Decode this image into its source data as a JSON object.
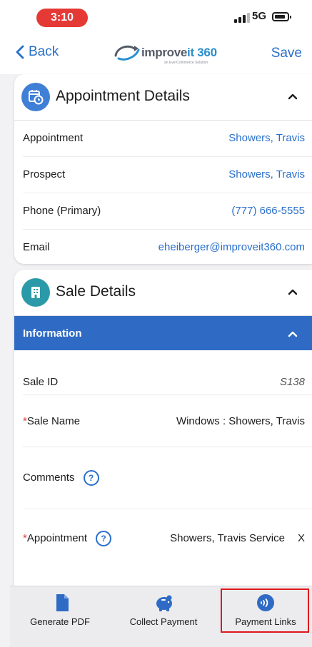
{
  "status": {
    "time": "3:10",
    "network": "5G"
  },
  "nav": {
    "back_label": "Back",
    "logo_main": "improve",
    "logo_accent": "it 360",
    "logo_sub": "an EverCommerce Solution",
    "save_label": "Save"
  },
  "appointment_details": {
    "title": "Appointment Details",
    "rows": [
      {
        "label": "Appointment",
        "value": "Showers, Travis"
      },
      {
        "label": "Prospect",
        "value": "Showers, Travis"
      },
      {
        "label": "Phone (Primary)",
        "value": "(777) 666-5555"
      },
      {
        "label": "Email",
        "value": "eheiberger@improveit360.com"
      }
    ]
  },
  "sale_details": {
    "title": "Sale Details",
    "section_label": "Information",
    "sale_id_label": "Sale ID",
    "sale_id_value": "S138",
    "sale_name_label": "Sale Name",
    "sale_name_value": "Windows : Showers, Travis",
    "comments_label": "Comments",
    "appointment_label": "Appointment",
    "appointment_value": "Showers, Travis Service",
    "appointment_clear": "X",
    "required_mark": "*",
    "help_glyph": "?"
  },
  "toolbar": {
    "generate_pdf": "Generate PDF",
    "collect_payment": "Collect Payment",
    "payment_links": "Payment Links"
  },
  "colors": {
    "accent_blue": "#2a6fca",
    "section_blue": "#2f6bc4",
    "status_red": "#e53935",
    "highlight_red": "#e0171c",
    "appt_icon": "#3f7fd6",
    "sale_icon": "#2a9aa8"
  }
}
